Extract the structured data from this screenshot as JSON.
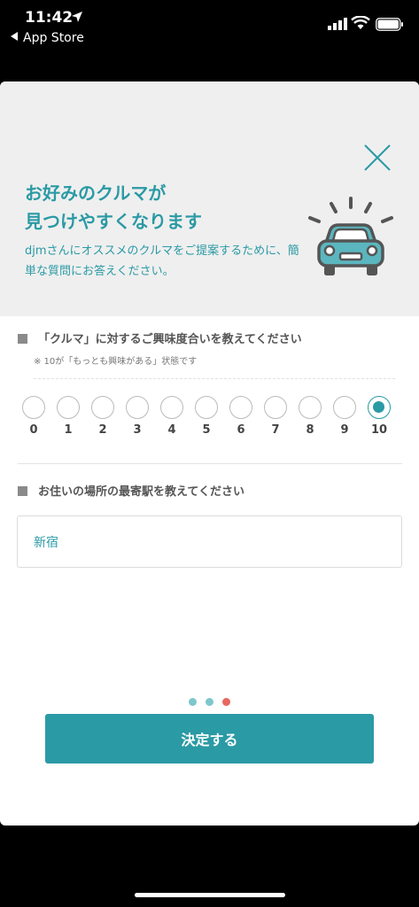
{
  "status_bar": {
    "time": "11:42",
    "back_app": "App Store"
  },
  "hero": {
    "title_line1": "お好みのクルマが",
    "title_line2": "見つけやすくなります",
    "description": "djmさんにオススメのクルマをご提案するために、簡単な質問にお答えください。"
  },
  "question1": {
    "label": "「クルマ」に対するご興味度合いを教えてください",
    "note": "※ 10が「もっとも興味がある」状態です",
    "options": [
      "0",
      "1",
      "2",
      "3",
      "4",
      "5",
      "6",
      "7",
      "8",
      "9",
      "10"
    ],
    "selected": "10"
  },
  "question2": {
    "label": "お住いの場所の最寄駅を教えてください",
    "value": "新宿"
  },
  "pager": {
    "total": 3,
    "current": 3
  },
  "submit": {
    "label": "決定する"
  },
  "colors": {
    "accent": "#2a9aa5",
    "pager_inactive": "#7ec7cc",
    "pager_active": "#e8675f"
  }
}
